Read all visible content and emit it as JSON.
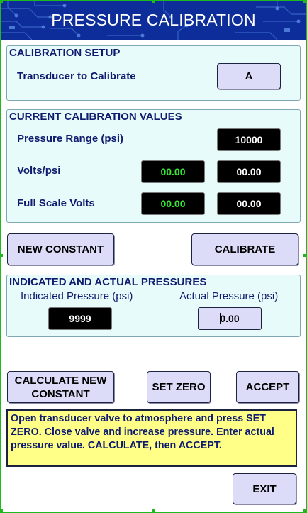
{
  "header": {
    "title": "PRESSURE CALIBRATION"
  },
  "setup": {
    "title": "CALIBRATION SETUP",
    "transducer_label": "Transducer to Calibrate",
    "transducer_value": "A"
  },
  "current": {
    "title": "CURRENT CALIBRATION VALUES",
    "pressure_range_label": "Pressure Range (psi)",
    "pressure_range_value": "10000",
    "volts_psi_label": "Volts/psi",
    "volts_psi_green": "00.00",
    "volts_psi_white": "00.00",
    "full_scale_label": "Full Scale Volts",
    "full_scale_green": "00.00",
    "full_scale_white": "00.00"
  },
  "actions": {
    "new_constant": "NEW CONSTANT",
    "calibrate": "CALIBRATE"
  },
  "pressures": {
    "title": "INDICATED AND ACTUAL PRESSURES",
    "indicated_label": "Indicated Pressure (psi)",
    "indicated_value": "9999",
    "actual_label": "Actual Pressure (psi)",
    "actual_value": "0.00"
  },
  "buttons": {
    "calculate_line1": "CALCULATE NEW",
    "calculate_line2": "CONSTANT",
    "set_zero": "SET ZERO",
    "accept": "ACCEPT",
    "exit": "EXIT"
  },
  "message": "Open transducer valve to atmosphere and press SET ZERO.  Close valve and increase pressure. Enter actual pressure value.  CALCULATE, then ACCEPT.",
  "colors": {
    "header_bg": "#0d2e9a",
    "panel_bg": "#e7fbfb",
    "label_text": "#0e1b6e",
    "green_value": "#36e836",
    "message_bg": "#ffff88",
    "selection_handles": "#1db91d"
  }
}
